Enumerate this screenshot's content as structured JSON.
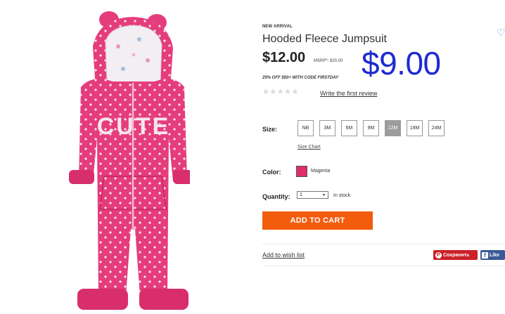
{
  "product": {
    "badge": "NEW ARRIVAL",
    "title": "Hooded Fleece Jumpsuit",
    "sale_price": "$12.00",
    "msrp": "MSRP*: $20.00",
    "big_price": "$9.00",
    "promo": "25% OFF $50+ WITH CODE FIRSTDAY",
    "image_text": "CUTE",
    "image_color": "#e53d7c"
  },
  "rating": {
    "stars": "★★★★★",
    "review_link": "Write the first review"
  },
  "size": {
    "label": "Size:",
    "options": [
      "NB",
      "3M",
      "6M",
      "9M",
      "12M",
      "18M",
      "24M"
    ],
    "selected": "12M",
    "chart_link": "Size Chart"
  },
  "color": {
    "label": "Color:",
    "name": "Magenta",
    "swatch": "#e02c6a"
  },
  "quantity": {
    "label": "Quantity:",
    "value": "1",
    "stock": "In stock"
  },
  "actions": {
    "add_to_cart": "ADD TO CART",
    "wishlist": "Add to wish list",
    "pinterest_label": "Сохранить",
    "facebook_label": "Like",
    "cta_color": "#f35b0d"
  },
  "icons": {
    "heart": "heart-icon",
    "pinterest": "pinterest-icon",
    "facebook": "facebook-icon",
    "dropdown": "chevron-down-icon"
  }
}
